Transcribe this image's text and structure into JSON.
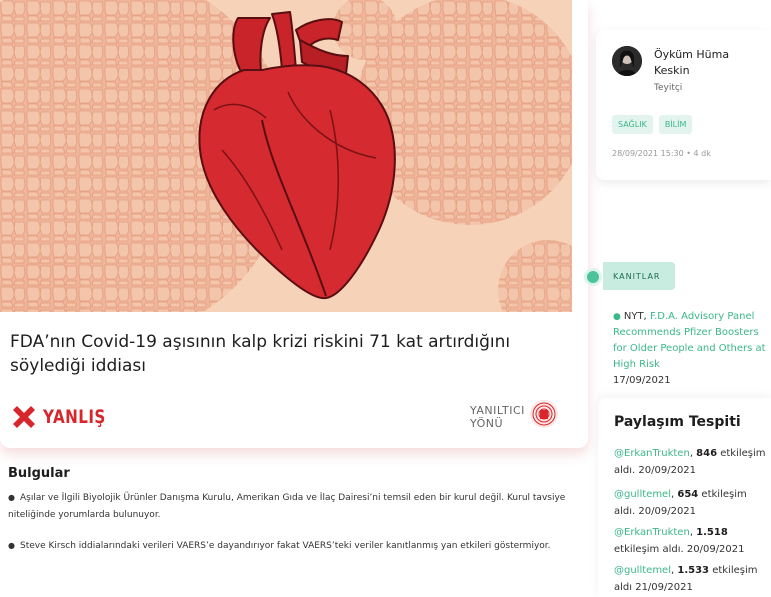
{
  "article": {
    "title": "FDA’nın Covid-19 aşısının kalp krizi riskini 71 kat artırdığını söylediği iddiası",
    "verdict": "YANLIŞ",
    "verdict_color": "#d8262c",
    "misleading_label_line1": "YANILTICI",
    "misleading_label_line2": "YÖNÜ",
    "hero_image_icon": "anatomical-heart-illustration"
  },
  "findings": {
    "heading": "Bulgular",
    "items": [
      "Aşılar ve İlgili Biyolojik Ürünler Danışma Kurulu, Amerikan Gıda ve İlaç Dairesi’ni temsil eden bir kurul değil. Kurul tavsiye niteliğinde yorumlarda bulunuyor.",
      "Steve Kirsch iddialarındaki verileri VAERS’e dayandırıyor fakat VAERS’teki veriler kanıtlanmış yan etkileri göstermiyor."
    ]
  },
  "author": {
    "name": "Öyküm Hüma Keskin",
    "role": "Teyitçi",
    "tags": [
      "SAĞLIK",
      "BİLİM"
    ],
    "date": "28/09/2021 15:30 • 4 dk"
  },
  "evidence": {
    "label": "KANITLAR",
    "source": "NYT,",
    "link_text": "F.D.A. Advisory Panel Recommends Pfizer Boosters for Older People and Others at High Risk",
    "date": "17/09/2021"
  },
  "shares": {
    "title": "Paylaşım Tespiti",
    "items": [
      {
        "handle": "@ErkanTrukten",
        "count": "846",
        "suffix": "etkileşim aldı. 20/09/2021"
      },
      {
        "handle": "@gulltemel",
        "count": "654",
        "suffix": "etkileşim aldı. 20/09/2021"
      },
      {
        "handle": "@ErkanTrukten",
        "count": "1.518",
        "suffix": "etkileşim aldı. 20/09/2021"
      },
      {
        "handle": "@gulltemel",
        "count": "1.533",
        "suffix": "etkileşim aldı 21/09/2021"
      }
    ]
  },
  "colors": {
    "accent_green": "#3bb889",
    "hero_background": "#f6d3b8",
    "heart_red": "#d52a2f"
  }
}
